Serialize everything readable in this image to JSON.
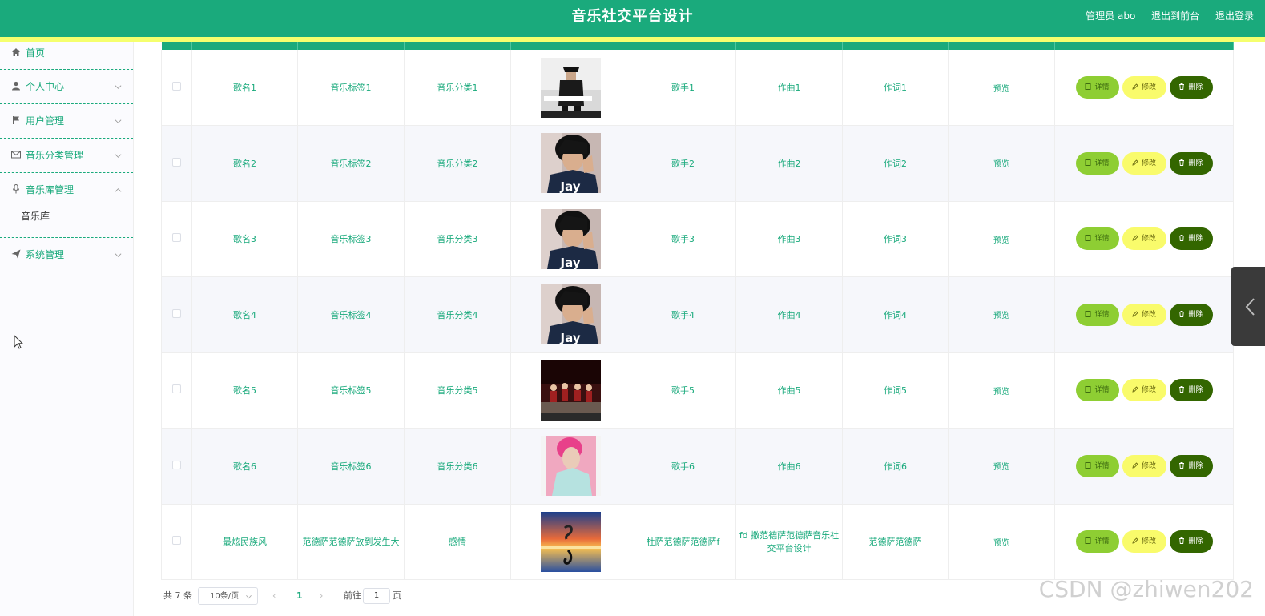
{
  "header": {
    "title": "音乐社交平台设计",
    "admin_label": "管理员 abo",
    "back_to_front": "退出到前台",
    "logout": "退出登录"
  },
  "sidebar": {
    "items": [
      {
        "label": "首页",
        "icon": "home-icon"
      },
      {
        "label": "个人中心",
        "icon": "user-icon"
      },
      {
        "label": "用户管理",
        "icon": "flag-icon"
      },
      {
        "label": "音乐分类管理",
        "icon": "mail-icon"
      },
      {
        "label": "音乐库管理",
        "icon": "microphone-icon",
        "expanded": true,
        "children": [
          {
            "label": "音乐库"
          }
        ]
      },
      {
        "label": "系统管理",
        "icon": "send-icon"
      }
    ]
  },
  "table": {
    "preview_label": "预览",
    "actions": {
      "detail": "详情",
      "edit": "修改",
      "delete": "删除"
    },
    "rows": [
      {
        "name": "歌名1",
        "tag": "音乐标签1",
        "category": "音乐分类1",
        "cover": "cover-1",
        "singer": "歌手1",
        "composer": "作曲1",
        "lyricist": "作词1"
      },
      {
        "name": "歌名2",
        "tag": "音乐标签2",
        "category": "音乐分类2",
        "cover": "cover-jay",
        "singer": "歌手2",
        "composer": "作曲2",
        "lyricist": "作词2"
      },
      {
        "name": "歌名3",
        "tag": "音乐标签3",
        "category": "音乐分类3",
        "cover": "cover-jay",
        "singer": "歌手3",
        "composer": "作曲3",
        "lyricist": "作词3"
      },
      {
        "name": "歌名4",
        "tag": "音乐标签4",
        "category": "音乐分类4",
        "cover": "cover-jay",
        "singer": "歌手4",
        "composer": "作曲4",
        "lyricist": "作词4"
      },
      {
        "name": "歌名5",
        "tag": "音乐标签5",
        "category": "音乐分类5",
        "cover": "cover-stage",
        "singer": "歌手5",
        "composer": "作曲5",
        "lyricist": "作词5"
      },
      {
        "name": "歌名6",
        "tag": "音乐标签6",
        "category": "音乐分类6",
        "cover": "cover-pink",
        "singer": "歌手6",
        "composer": "作曲6",
        "lyricist": "作词6"
      },
      {
        "name": "最炫民族风",
        "tag": "范德萨范德萨放到发生大",
        "category": "感情",
        "cover": "cover-sunset",
        "singer": "杜萨范德萨范德萨f",
        "composer": "fd 撒范德萨范德萨音乐社交平台设计",
        "lyricist": "范德萨范德萨"
      }
    ]
  },
  "pagination": {
    "total": "共 7 条",
    "page_size": "10条/页",
    "current_page": "1",
    "goto_label": "前往",
    "goto_value": "1",
    "page_suffix": "页"
  },
  "watermark": "CSDN @zhiwen202",
  "colors": {
    "primary": "#1aaa7c",
    "accent_stripe": "#f5ff6e",
    "detail_btn": "#8ece33",
    "edit_btn": "#f9fb6b",
    "delete_btn": "#336600"
  }
}
